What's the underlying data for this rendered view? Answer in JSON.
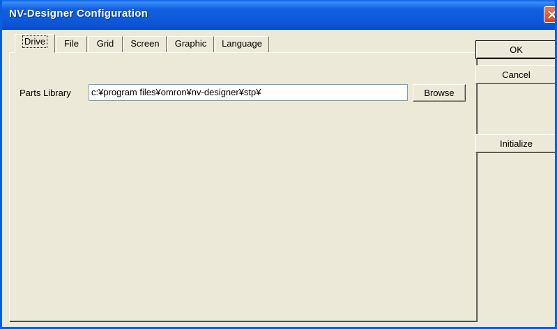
{
  "window": {
    "title": "NV-Designer Configuration"
  },
  "tabs": [
    {
      "label": "Drive",
      "active": true
    },
    {
      "label": "File",
      "active": false
    },
    {
      "label": "Grid",
      "active": false
    },
    {
      "label": "Screen",
      "active": false
    },
    {
      "label": "Graphic",
      "active": false
    },
    {
      "label": "Language",
      "active": false
    }
  ],
  "drive": {
    "parts_library_label": "Parts Library",
    "parts_library_value": "c:¥program files¥omron¥nv-designer¥stp¥",
    "browse_label": "Browse"
  },
  "buttons": {
    "ok": "OK",
    "cancel": "Cancel",
    "initialize": "Initialize"
  },
  "colors": {
    "titlebar": "#0a5ee0",
    "dialog_bg": "#ece9d8",
    "close_button": "#d5441e"
  }
}
